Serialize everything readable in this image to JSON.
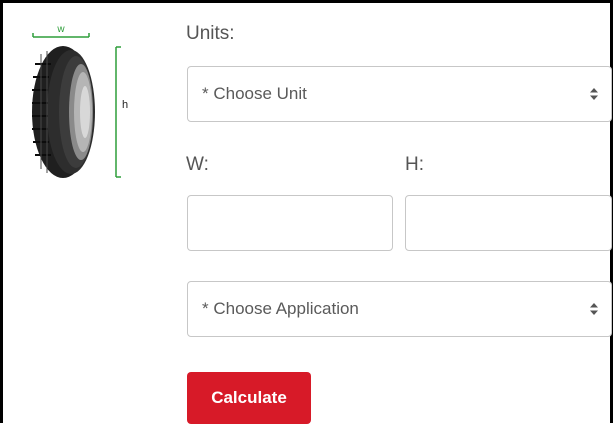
{
  "form": {
    "units_label": "Units:",
    "units_placeholder": "* Choose Unit",
    "w_label": "W:",
    "h_label": "H:",
    "w_value": "",
    "h_value": "",
    "application_placeholder": "* Choose Application",
    "calculate_label": "Calculate"
  },
  "figure": {
    "width_marker": "w",
    "height_marker": "h"
  },
  "colors": {
    "accent": "#d71a28",
    "dimension_lines": "#2e9e3a"
  }
}
